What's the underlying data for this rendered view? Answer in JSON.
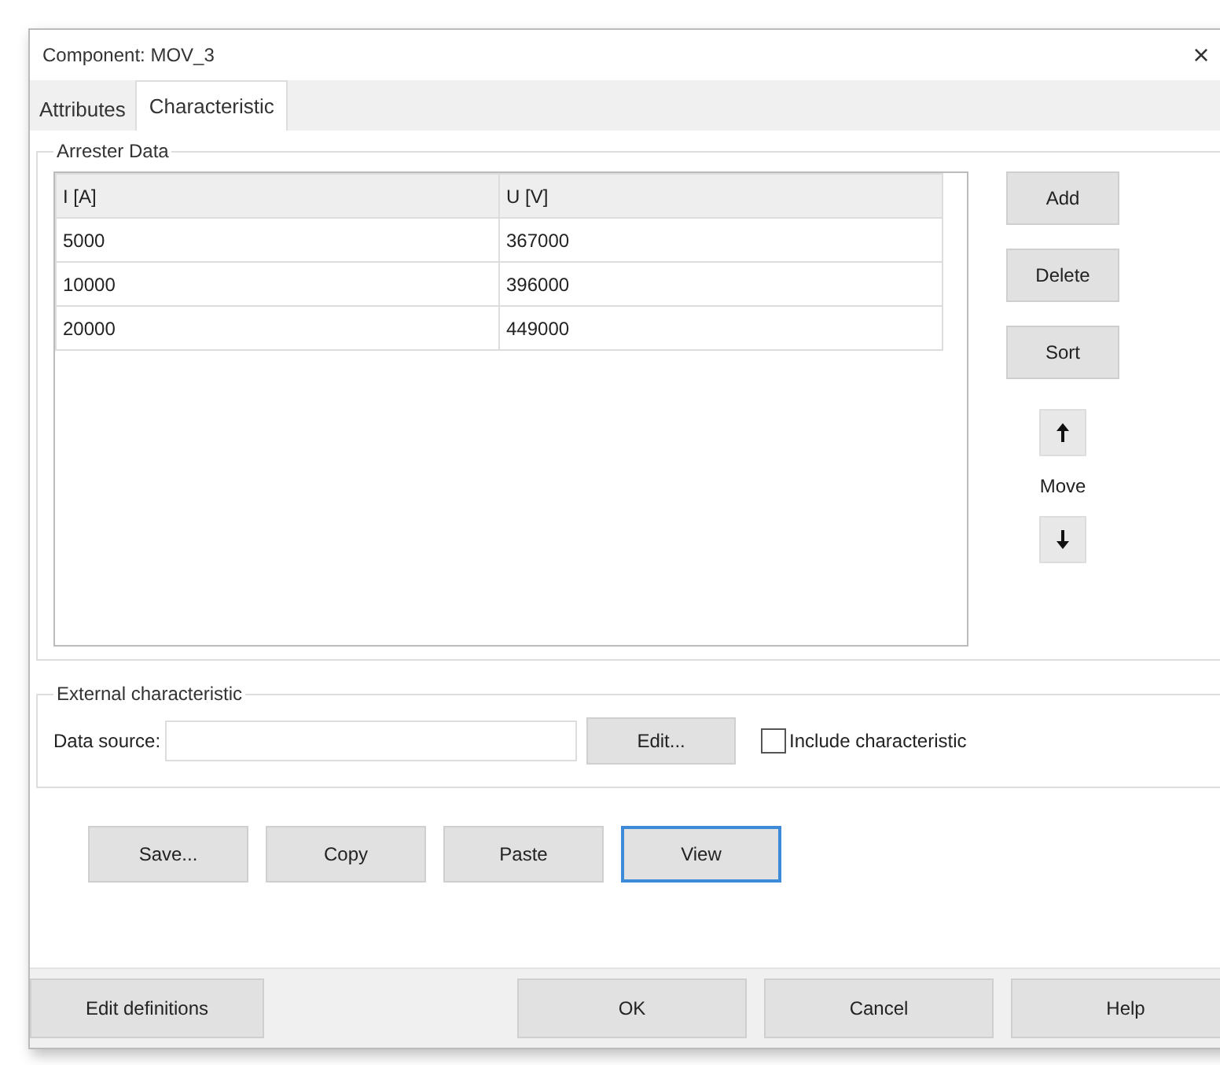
{
  "window": {
    "title": "Component: MOV_3",
    "close": "×"
  },
  "tabs": [
    {
      "label": "Attributes",
      "selected": false
    },
    {
      "label": "Characteristic",
      "selected": true
    }
  ],
  "arrester_data": {
    "title": "Arrester Data",
    "table": {
      "columns": [
        "I [A]",
        "U [V]"
      ],
      "rows": [
        [
          "5000",
          "367000"
        ],
        [
          "10000",
          "396000"
        ],
        [
          "20000",
          "449000"
        ]
      ]
    },
    "buttons": [
      "Add",
      "Delete",
      "Sort"
    ],
    "move": {
      "label": "Move"
    }
  },
  "external": {
    "title": "External characteristic",
    "data_source_label": "Data source:",
    "edit_button": "Edit...",
    "include": {
      "label": "Include characteristic",
      "checked": false
    }
  },
  "actions": [
    {
      "label": "Save...",
      "focused": false
    },
    {
      "label": "Copy",
      "focused": false
    },
    {
      "label": "Paste",
      "focused": false
    },
    {
      "label": "View",
      "focused": true
    }
  ],
  "footer": {
    "left": "Edit definitions",
    "buttons": [
      "OK",
      "Cancel",
      "Help"
    ]
  }
}
